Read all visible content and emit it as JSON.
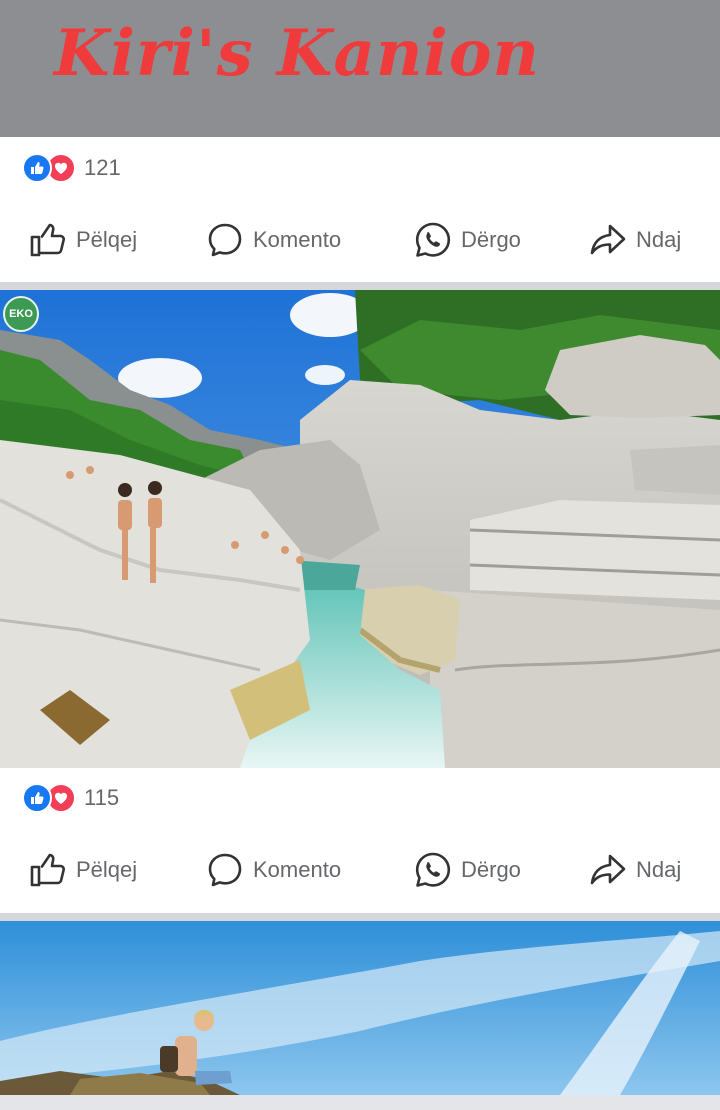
{
  "header": {
    "title": "Kiri's Kanion"
  },
  "actions": {
    "like_label": "Pëlqej",
    "comment_label": "Komento",
    "send_label": "Dërgo",
    "share_label": "Ndaj"
  },
  "posts": [
    {
      "reaction_count": "121"
    },
    {
      "reaction_count": "115",
      "photo": {
        "badge": "EKO"
      }
    }
  ],
  "colors": {
    "accent": "#1877f2",
    "love": "#f33e58",
    "title": "#ef3b3b",
    "header_bg": "#8d8e92"
  },
  "icons": [
    "like-reaction-icon",
    "love-reaction-icon",
    "thumbs-up-icon",
    "comment-bubble-icon",
    "whatsapp-icon",
    "share-arrow-icon"
  ]
}
